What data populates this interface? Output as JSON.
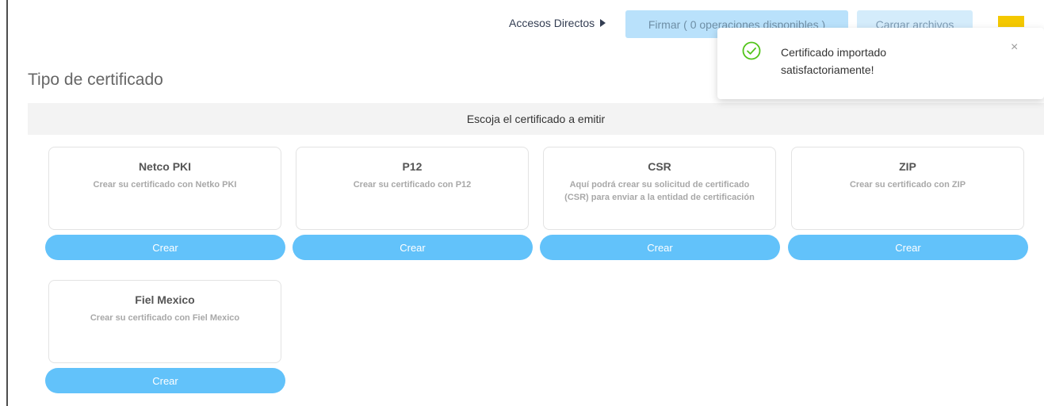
{
  "header": {
    "shortcuts_label": "Accesos Directos",
    "sign_button": "Firmar ( 0 operaciones disponibles )",
    "upload_button": "Cargar archivos"
  },
  "page_title": "Tipo de certificado",
  "instruction": "Escoja el certificado a emitir",
  "cards": [
    {
      "title": "Netco PKI",
      "description": "Crear su certificado con Netko PKI",
      "button": "Crear"
    },
    {
      "title": "P12",
      "description": "Crear su certificado con P12",
      "button": "Crear"
    },
    {
      "title": "CSR",
      "description": "Aquí podrá crear su solicitud de certificado (CSR) para enviar a la entidad de certificación",
      "button": "Crear"
    },
    {
      "title": "ZIP",
      "description": "Crear su certificado con ZIP",
      "button": "Crear"
    },
    {
      "title": "Fiel Mexico",
      "description": "Crear su certificado con Fiel Mexico",
      "button": "Crear"
    }
  ],
  "toast": {
    "message": "Certificado importado satisfactoriamente!",
    "close_symbol": "×",
    "icon": "check-circle-icon",
    "icon_color": "#52c41a"
  },
  "colors": {
    "accent": "#62c2fa",
    "sign_button_bg": "#b9e1fb",
    "upload_button_bg": "#d4ecfb",
    "yellow_chip": "#f4c800"
  }
}
